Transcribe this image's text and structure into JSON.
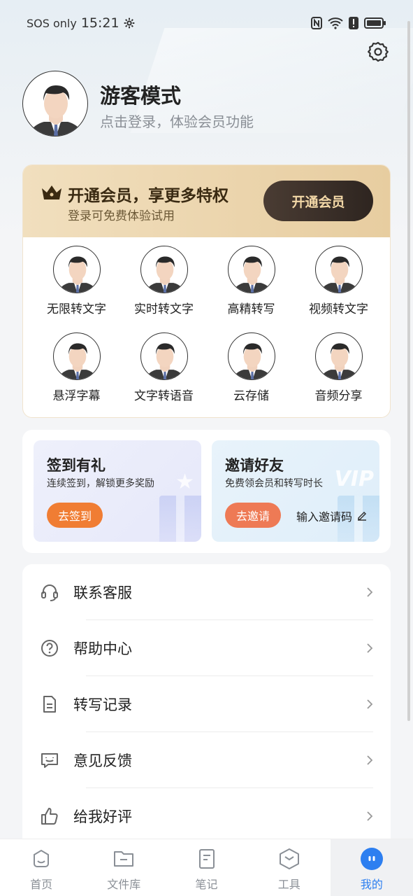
{
  "status_bar": {
    "carrier": "SOS only",
    "time": "15:21"
  },
  "profile": {
    "name": "游客模式",
    "subtitle": "点击登录，体验会员功能"
  },
  "vip": {
    "title": "开通会员，享更多特权",
    "subtitle": "登录可免费体验试用",
    "button": "开通会员",
    "features": [
      {
        "label": "无限转文字"
      },
      {
        "label": "实时转文字"
      },
      {
        "label": "高精转写"
      },
      {
        "label": "视频转文字"
      },
      {
        "label": "悬浮字幕"
      },
      {
        "label": "文字转语音"
      },
      {
        "label": "云存储"
      },
      {
        "label": "音频分享"
      }
    ]
  },
  "promos": {
    "sign_in": {
      "title": "签到有礼",
      "subtitle": "连续签到，解锁更多奖励",
      "button": "去签到"
    },
    "invite": {
      "title": "邀请好友",
      "subtitle": "免费领会员和转写时长",
      "button": "去邀请",
      "code_label": "输入邀请码",
      "watermark": "VIP"
    }
  },
  "menu": {
    "items": [
      {
        "label": "联系客服",
        "icon": "headset-icon"
      },
      {
        "label": "帮助中心",
        "icon": "help-icon"
      },
      {
        "label": "转写记录",
        "icon": "document-icon"
      },
      {
        "label": "意见反馈",
        "icon": "feedback-icon"
      },
      {
        "label": "给我好评",
        "icon": "thumbs-up-icon"
      }
    ]
  },
  "bottom_nav": {
    "items": [
      {
        "label": "首页",
        "icon": "home-icon"
      },
      {
        "label": "文件库",
        "icon": "folder-icon"
      },
      {
        "label": "笔记",
        "icon": "note-icon"
      },
      {
        "label": "工具",
        "icon": "tools-icon"
      },
      {
        "label": "我的",
        "icon": "profile-icon",
        "active": true
      }
    ]
  },
  "colors": {
    "accent_blue": "#2d7ff0",
    "vip_gold": "#e7cda0",
    "sign_button": "#f07d33",
    "invite_button": "#ee7a55"
  }
}
